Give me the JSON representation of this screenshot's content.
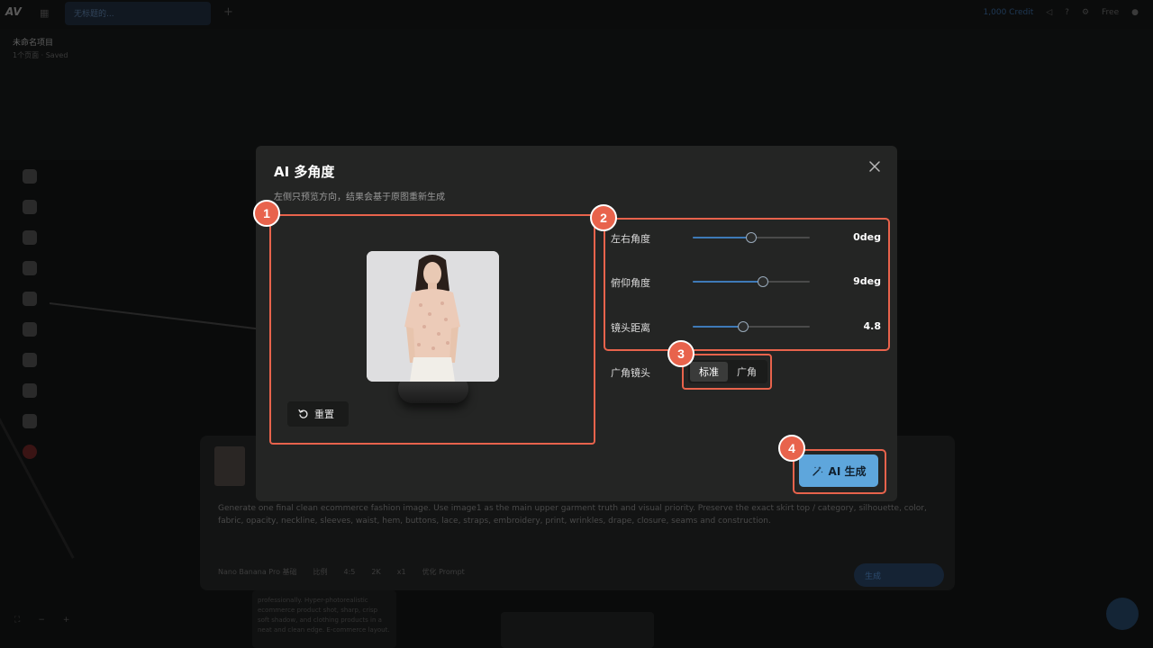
{
  "background": {
    "logo": "AV",
    "tab_label": "无标题的...",
    "top_right": [
      "1,000 Credit",
      "Free"
    ],
    "project_name": "未命名项目",
    "project_meta": "1个页面 · Saved",
    "panel_text": "Generate one final clean ecommerce fashion image. Use image1 as the main upper garment truth and visual priority. Preserve the exact skirt top / category, silhouette, color, fabric, opacity, neckline, sleeves, waist, hem, buttons, lace, straps, embroidery, print, wrinkles, drape, closure, seams and construction.",
    "panel_model": "Nano Banana Pro 基础",
    "panel_controls": [
      "比例",
      "4:5",
      "2K",
      "x1"
    ],
    "panel_prompt_toggle": "优化 Prompt",
    "send_label": "生成",
    "card_text": "professionally. Hyper-photorealistic ecommerce product shot, sharp, crisp soft shadow, and clothing products in a neat and clean edge. E-commerce layout."
  },
  "modal": {
    "title": "AI 多角度",
    "subtitle": "左侧只预览方向，结果会基于原图重新生成",
    "reset_label": "重置",
    "sliders": [
      {
        "label": "左右角度",
        "value": "0deg",
        "fraction": 0.5
      },
      {
        "label": "俯仰角度",
        "value": "9deg",
        "fraction": 0.6
      },
      {
        "label": "镜头距离",
        "value": "4.8",
        "fraction": 0.43
      }
    ],
    "lens": {
      "label": "广角镜头",
      "options": [
        "标准",
        "广角"
      ],
      "selected": "标准"
    },
    "generate_label": "AI 生成"
  },
  "badges": [
    "1",
    "2",
    "3",
    "4"
  ],
  "colors": {
    "annotation": "#e8634c",
    "accent": "#5ea6dc",
    "modal_bg": "#242524"
  }
}
